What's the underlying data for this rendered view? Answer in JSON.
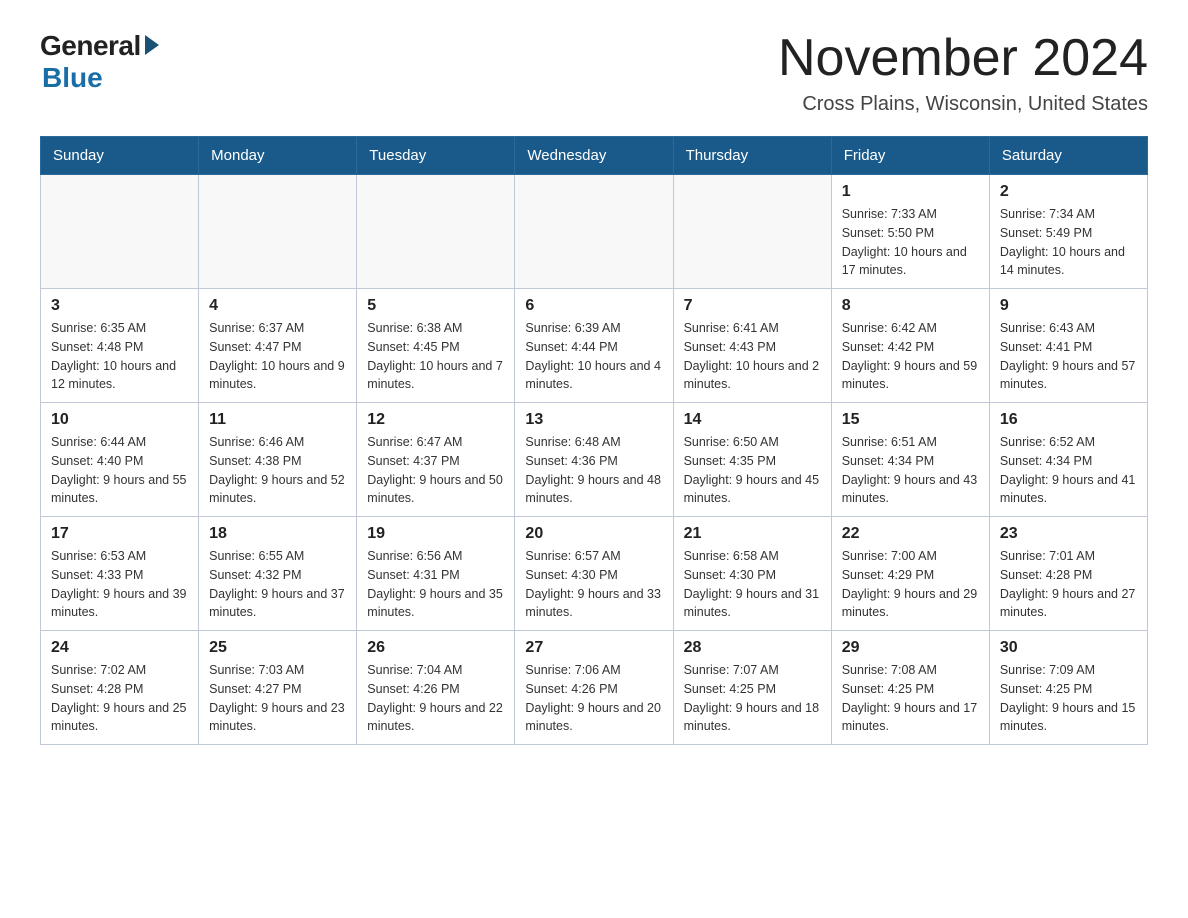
{
  "logo": {
    "general": "General",
    "blue": "Blue"
  },
  "title": "November 2024",
  "subtitle": "Cross Plains, Wisconsin, United States",
  "days_of_week": [
    "Sunday",
    "Monday",
    "Tuesday",
    "Wednesday",
    "Thursday",
    "Friday",
    "Saturday"
  ],
  "weeks": [
    [
      {
        "day": "",
        "sunrise": "",
        "sunset": "",
        "daylight": ""
      },
      {
        "day": "",
        "sunrise": "",
        "sunset": "",
        "daylight": ""
      },
      {
        "day": "",
        "sunrise": "",
        "sunset": "",
        "daylight": ""
      },
      {
        "day": "",
        "sunrise": "",
        "sunset": "",
        "daylight": ""
      },
      {
        "day": "",
        "sunrise": "",
        "sunset": "",
        "daylight": ""
      },
      {
        "day": "1",
        "sunrise": "Sunrise: 7:33 AM",
        "sunset": "Sunset: 5:50 PM",
        "daylight": "Daylight: 10 hours and 17 minutes."
      },
      {
        "day": "2",
        "sunrise": "Sunrise: 7:34 AM",
        "sunset": "Sunset: 5:49 PM",
        "daylight": "Daylight: 10 hours and 14 minutes."
      }
    ],
    [
      {
        "day": "3",
        "sunrise": "Sunrise: 6:35 AM",
        "sunset": "Sunset: 4:48 PM",
        "daylight": "Daylight: 10 hours and 12 minutes."
      },
      {
        "day": "4",
        "sunrise": "Sunrise: 6:37 AM",
        "sunset": "Sunset: 4:47 PM",
        "daylight": "Daylight: 10 hours and 9 minutes."
      },
      {
        "day": "5",
        "sunrise": "Sunrise: 6:38 AM",
        "sunset": "Sunset: 4:45 PM",
        "daylight": "Daylight: 10 hours and 7 minutes."
      },
      {
        "day": "6",
        "sunrise": "Sunrise: 6:39 AM",
        "sunset": "Sunset: 4:44 PM",
        "daylight": "Daylight: 10 hours and 4 minutes."
      },
      {
        "day": "7",
        "sunrise": "Sunrise: 6:41 AM",
        "sunset": "Sunset: 4:43 PM",
        "daylight": "Daylight: 10 hours and 2 minutes."
      },
      {
        "day": "8",
        "sunrise": "Sunrise: 6:42 AM",
        "sunset": "Sunset: 4:42 PM",
        "daylight": "Daylight: 9 hours and 59 minutes."
      },
      {
        "day": "9",
        "sunrise": "Sunrise: 6:43 AM",
        "sunset": "Sunset: 4:41 PM",
        "daylight": "Daylight: 9 hours and 57 minutes."
      }
    ],
    [
      {
        "day": "10",
        "sunrise": "Sunrise: 6:44 AM",
        "sunset": "Sunset: 4:40 PM",
        "daylight": "Daylight: 9 hours and 55 minutes."
      },
      {
        "day": "11",
        "sunrise": "Sunrise: 6:46 AM",
        "sunset": "Sunset: 4:38 PM",
        "daylight": "Daylight: 9 hours and 52 minutes."
      },
      {
        "day": "12",
        "sunrise": "Sunrise: 6:47 AM",
        "sunset": "Sunset: 4:37 PM",
        "daylight": "Daylight: 9 hours and 50 minutes."
      },
      {
        "day": "13",
        "sunrise": "Sunrise: 6:48 AM",
        "sunset": "Sunset: 4:36 PM",
        "daylight": "Daylight: 9 hours and 48 minutes."
      },
      {
        "day": "14",
        "sunrise": "Sunrise: 6:50 AM",
        "sunset": "Sunset: 4:35 PM",
        "daylight": "Daylight: 9 hours and 45 minutes."
      },
      {
        "day": "15",
        "sunrise": "Sunrise: 6:51 AM",
        "sunset": "Sunset: 4:34 PM",
        "daylight": "Daylight: 9 hours and 43 minutes."
      },
      {
        "day": "16",
        "sunrise": "Sunrise: 6:52 AM",
        "sunset": "Sunset: 4:34 PM",
        "daylight": "Daylight: 9 hours and 41 minutes."
      }
    ],
    [
      {
        "day": "17",
        "sunrise": "Sunrise: 6:53 AM",
        "sunset": "Sunset: 4:33 PM",
        "daylight": "Daylight: 9 hours and 39 minutes."
      },
      {
        "day": "18",
        "sunrise": "Sunrise: 6:55 AM",
        "sunset": "Sunset: 4:32 PM",
        "daylight": "Daylight: 9 hours and 37 minutes."
      },
      {
        "day": "19",
        "sunrise": "Sunrise: 6:56 AM",
        "sunset": "Sunset: 4:31 PM",
        "daylight": "Daylight: 9 hours and 35 minutes."
      },
      {
        "day": "20",
        "sunrise": "Sunrise: 6:57 AM",
        "sunset": "Sunset: 4:30 PM",
        "daylight": "Daylight: 9 hours and 33 minutes."
      },
      {
        "day": "21",
        "sunrise": "Sunrise: 6:58 AM",
        "sunset": "Sunset: 4:30 PM",
        "daylight": "Daylight: 9 hours and 31 minutes."
      },
      {
        "day": "22",
        "sunrise": "Sunrise: 7:00 AM",
        "sunset": "Sunset: 4:29 PM",
        "daylight": "Daylight: 9 hours and 29 minutes."
      },
      {
        "day": "23",
        "sunrise": "Sunrise: 7:01 AM",
        "sunset": "Sunset: 4:28 PM",
        "daylight": "Daylight: 9 hours and 27 minutes."
      }
    ],
    [
      {
        "day": "24",
        "sunrise": "Sunrise: 7:02 AM",
        "sunset": "Sunset: 4:28 PM",
        "daylight": "Daylight: 9 hours and 25 minutes."
      },
      {
        "day": "25",
        "sunrise": "Sunrise: 7:03 AM",
        "sunset": "Sunset: 4:27 PM",
        "daylight": "Daylight: 9 hours and 23 minutes."
      },
      {
        "day": "26",
        "sunrise": "Sunrise: 7:04 AM",
        "sunset": "Sunset: 4:26 PM",
        "daylight": "Daylight: 9 hours and 22 minutes."
      },
      {
        "day": "27",
        "sunrise": "Sunrise: 7:06 AM",
        "sunset": "Sunset: 4:26 PM",
        "daylight": "Daylight: 9 hours and 20 minutes."
      },
      {
        "day": "28",
        "sunrise": "Sunrise: 7:07 AM",
        "sunset": "Sunset: 4:25 PM",
        "daylight": "Daylight: 9 hours and 18 minutes."
      },
      {
        "day": "29",
        "sunrise": "Sunrise: 7:08 AM",
        "sunset": "Sunset: 4:25 PM",
        "daylight": "Daylight: 9 hours and 17 minutes."
      },
      {
        "day": "30",
        "sunrise": "Sunrise: 7:09 AM",
        "sunset": "Sunset: 4:25 PM",
        "daylight": "Daylight: 9 hours and 15 minutes."
      }
    ]
  ]
}
